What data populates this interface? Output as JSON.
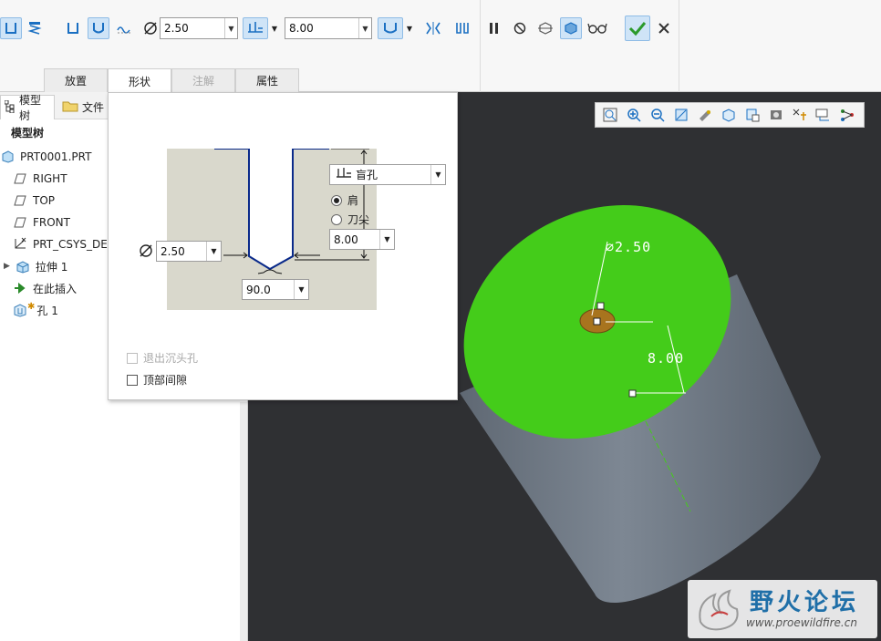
{
  "ribbon": {
    "diameter_value": "2.50",
    "depth_value": "8.00",
    "tabs": [
      {
        "label": "放置"
      },
      {
        "label": "形状"
      },
      {
        "label": "注解"
      },
      {
        "label": "属性"
      }
    ]
  },
  "left_panel": {
    "tabs": [
      {
        "label": "模型树"
      },
      {
        "label": "文件"
      }
    ],
    "tree_header": "模型树",
    "tree": [
      {
        "label": "PRT0001.PRT",
        "icon": "part-icon"
      },
      {
        "label": "RIGHT",
        "icon": "datum-plane-icon"
      },
      {
        "label": "TOP",
        "icon": "datum-plane-icon"
      },
      {
        "label": "FRONT",
        "icon": "datum-plane-icon"
      },
      {
        "label": "PRT_CSYS_DE",
        "icon": "csys-icon"
      },
      {
        "label": "拉伸 1",
        "icon": "extrude-icon"
      },
      {
        "label": "在此插入",
        "icon": "insert-here-arrow-icon"
      },
      {
        "label": "孔 1",
        "icon": "hole-feature-icon"
      }
    ]
  },
  "shape_panel": {
    "depth_type": "盲孔",
    "radio_shoulder": "肩",
    "radio_tip": "刀尖",
    "depth_value": "8.00",
    "diameter_value": "2.50",
    "angle_value": "90.0",
    "checkbox_exit_countersink": "退出沉头孔",
    "checkbox_top_clearance": "顶部间隙"
  },
  "viewport": {
    "dim_diameter": "⌀2.50",
    "dim_depth": "8.00"
  },
  "watermark": {
    "title": "野火论坛",
    "url": "www.proewildfire.cn"
  },
  "colors": {
    "top_face": "#44cc1a",
    "cylinder": "#6d7682",
    "background": "#2f3033",
    "accent": "#1a6fc2"
  }
}
